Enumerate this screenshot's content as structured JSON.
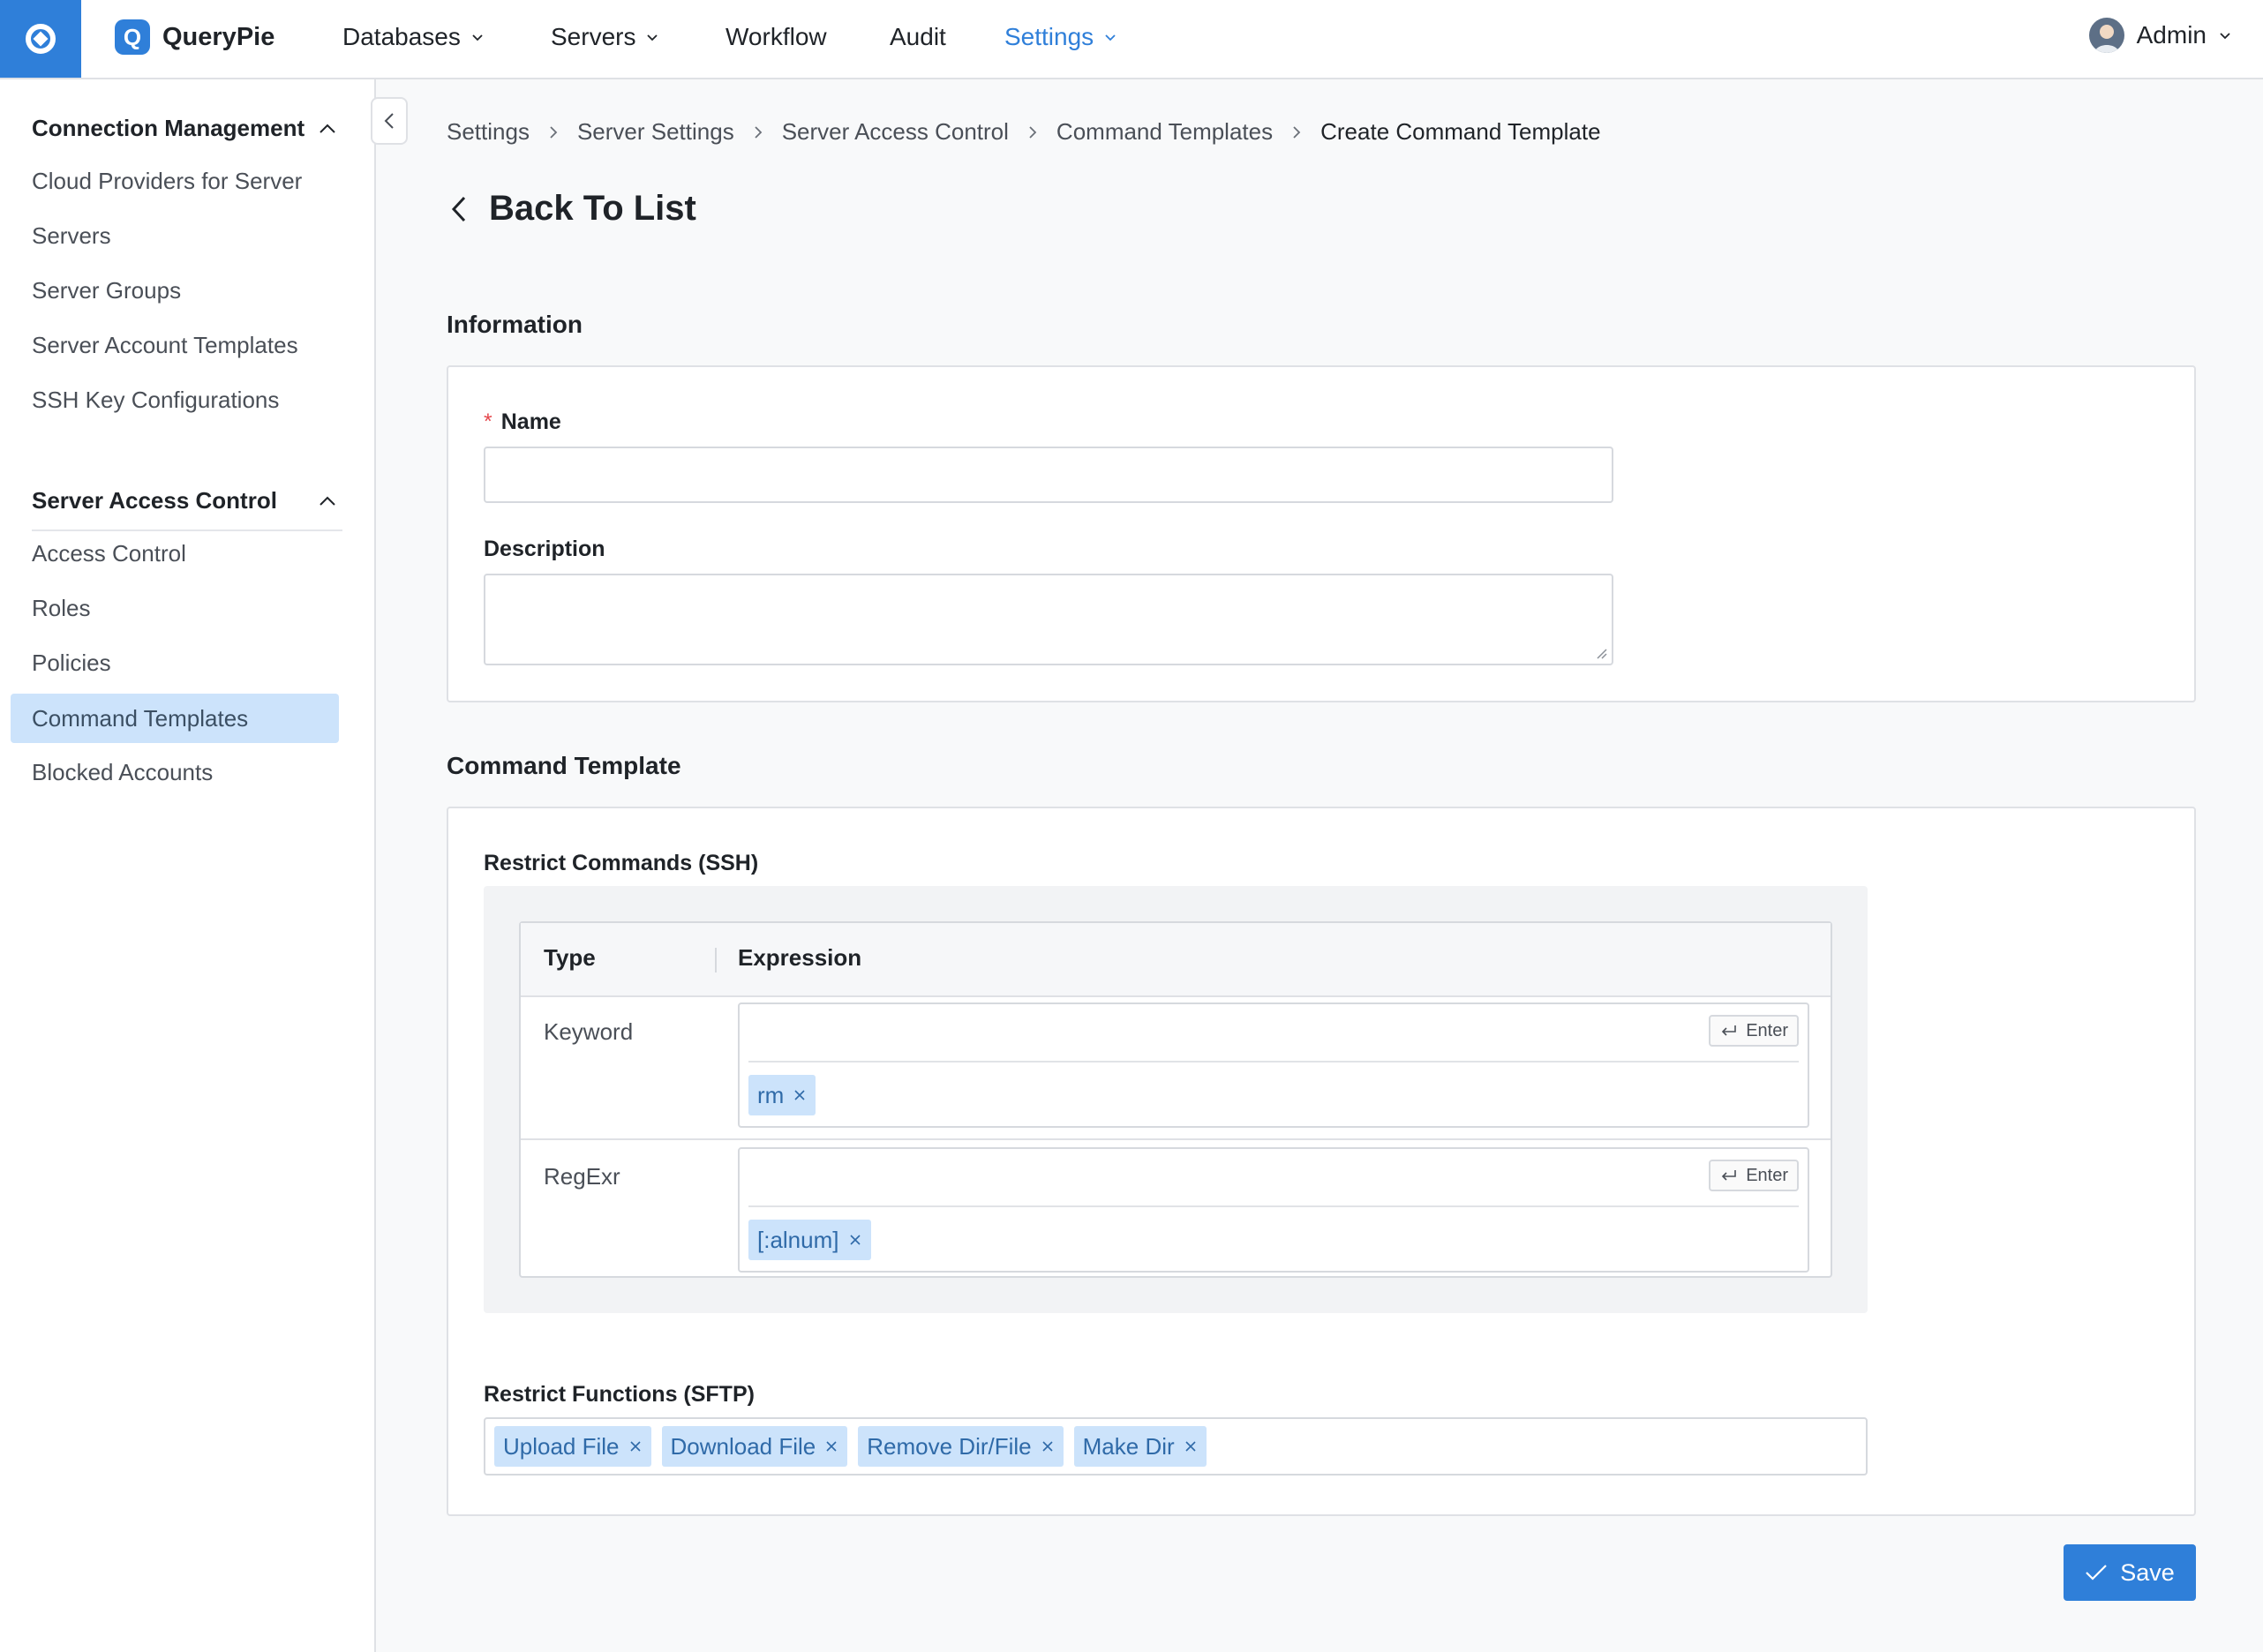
{
  "app": {
    "brand": "QueryPie"
  },
  "topnav": {
    "items": [
      {
        "label": "Databases"
      },
      {
        "label": "Servers"
      },
      {
        "label": "Workflow"
      },
      {
        "label": "Audit"
      },
      {
        "label": "Settings"
      }
    ],
    "user": "Admin",
    "active_color": "#2f7fd9"
  },
  "sidebar": {
    "sections": [
      {
        "title": "Connection Management",
        "items": [
          "Cloud Providers for Server",
          "Servers",
          "Server Groups",
          "Server Account Templates",
          "SSH Key Configurations"
        ]
      },
      {
        "title": "Server Access Control",
        "items": [
          "Access Control",
          "Roles",
          "Policies",
          "Command Templates",
          "Blocked Accounts"
        ]
      }
    ],
    "selected_item": "Command Templates"
  },
  "breadcrumb": [
    "Settings",
    "Server Settings",
    "Server Access Control",
    "Command Templates",
    "Create Command Template"
  ],
  "back_label": "Back To List",
  "information": {
    "title": "Information",
    "name_label": "Name",
    "required_mark": "*",
    "name_value": "",
    "description_label": "Description",
    "description_value": ""
  },
  "command_template": {
    "title": "Command Template",
    "ssh_label": "Restrict Commands (SSH)",
    "table": {
      "headers": [
        "Type",
        "Expression"
      ],
      "rows": [
        {
          "type": "Keyword",
          "input_value": "",
          "enter_label": "Enter",
          "tags": [
            "rm"
          ]
        },
        {
          "type": "RegExr",
          "input_value": "",
          "enter_label": "Enter",
          "tags": [
            "[:alnum]"
          ]
        }
      ]
    },
    "sftp_label": "Restrict Functions (SFTP)",
    "sftp_tags": [
      "Upload File",
      "Download File",
      "Remove Dir/File",
      "Make Dir"
    ]
  },
  "save_label": "Save"
}
